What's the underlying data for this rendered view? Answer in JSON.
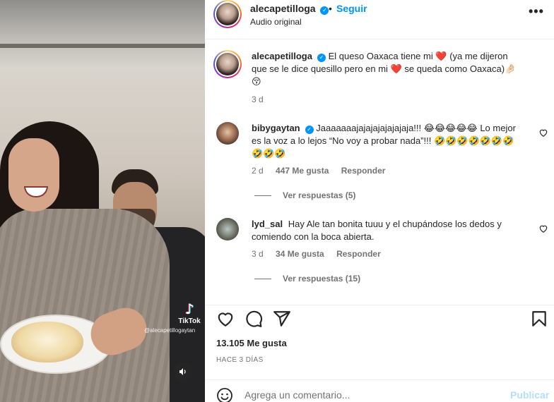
{
  "video": {
    "tiktok_label": "TikTok",
    "tiktok_handle": "@alecapetillogaytan"
  },
  "header": {
    "username": "alecapetilloga",
    "separator": "•",
    "follow_label": "Seguir",
    "audio": "Audio original",
    "more_label": "•••"
  },
  "caption": {
    "username": "alecapetilloga",
    "text_1": "El queso Oaxaca tiene mi",
    "text_2": "(ya me dijeron que se le dice quesillo pero en mi",
    "text_3": "se queda como Oaxaca)🤌🏻 😚",
    "heart": "❤️",
    "time": "3 d"
  },
  "comments": [
    {
      "username": "bibygaytan",
      "text": "Jaaaaaaajajajajajajajaja!!! 😂😂😂😂😂 Lo mejor es la voz a lo lejos “No voy a probar nada”!!! 🤣🤣🤣🤣🤣🤣🤣🤣🤣🤣",
      "time": "2 d",
      "likes": "447 Me gusta",
      "reply": "Responder",
      "view_replies": "Ver respuestas (5)"
    },
    {
      "username": "lyd_sal",
      "text": "Hay Ale tan bonita tuuu y el chupándose los dedos y comiendo con la boca abierta.",
      "time": "3 d",
      "likes": "34 Me gusta",
      "reply": "Responder",
      "view_replies": "Ver respuestas (15)"
    }
  ],
  "actions": {
    "likes": "13.105 Me gusta",
    "posted": "HACE 3 DÍAS"
  },
  "add_comment": {
    "placeholder": "Agrega un comentario...",
    "publish": "Publicar"
  },
  "colors": {
    "link_blue": "#0095f6",
    "muted": "#737373",
    "heart_red": "#ed1c3a",
    "publish_disabled": "#b2dffc"
  }
}
